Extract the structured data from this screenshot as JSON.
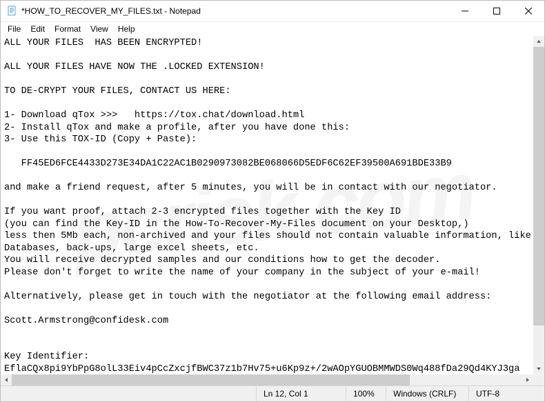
{
  "window": {
    "title": "*HOW_TO_RECOVER_MY_FILES.txt - Notepad"
  },
  "menu": {
    "file": "File",
    "edit": "Edit",
    "format": "Format",
    "view": "View",
    "help": "Help"
  },
  "document": {
    "text": "ALL YOUR FILES  HAS BEEN ENCRYPTED!\n\nALL YOUR FILES HAVE NOW THE .LOCKED EXTENSION!\n\nTO DE-CRYPT YOUR FILES, CONTACT US HERE:\n\n1- Download qTox >>>   https://tox.chat/download.html\n2- Install qTox and make a profile, after you have done this:\n3- Use this TOX-ID (Copy + Paste):\n\n   FF45ED6FCE4433D273E34DA1C22AC1B0290973082BE068066D5EDF6C62EF39500A691BDE33B9\n\nand make a friend request, after 5 minutes, you will be in contact with our negotiator.\n\nIf you want proof, attach 2-3 encrypted files together with the Key ID\n(you can find the Key-ID in the How-To-Recover-My-Files document on your Desktop,)\nless then 5Mb each, non-archived and your files should not contain valuable information, like\nDatabases, back-ups, large excel sheets, etc.\nYou will receive decrypted samples and our conditions how to get the decoder.\nPlease don't forget to write the name of your company in the subject of your e-mail!\n\nAlternatively, please get in touch with the negotiator at the following email address:\n\nScott.Armstrong@confidesk.com\n\n\nKey Identifier:\nEflaCQx8pi9YbPpG8olL33Eiv4pCcZxcjfBWC37z1b7Hv75+u6Kp9z+/2wAOpYGUOBMMWDS0Wq488fDa29Qd4KYJ3ga"
  },
  "statusbar": {
    "position": "Ln 12, Col 1",
    "zoom": "100%",
    "lineending": "Windows (CRLF)",
    "encoding": "UTF-8"
  },
  "watermark": "pcrisk.com"
}
